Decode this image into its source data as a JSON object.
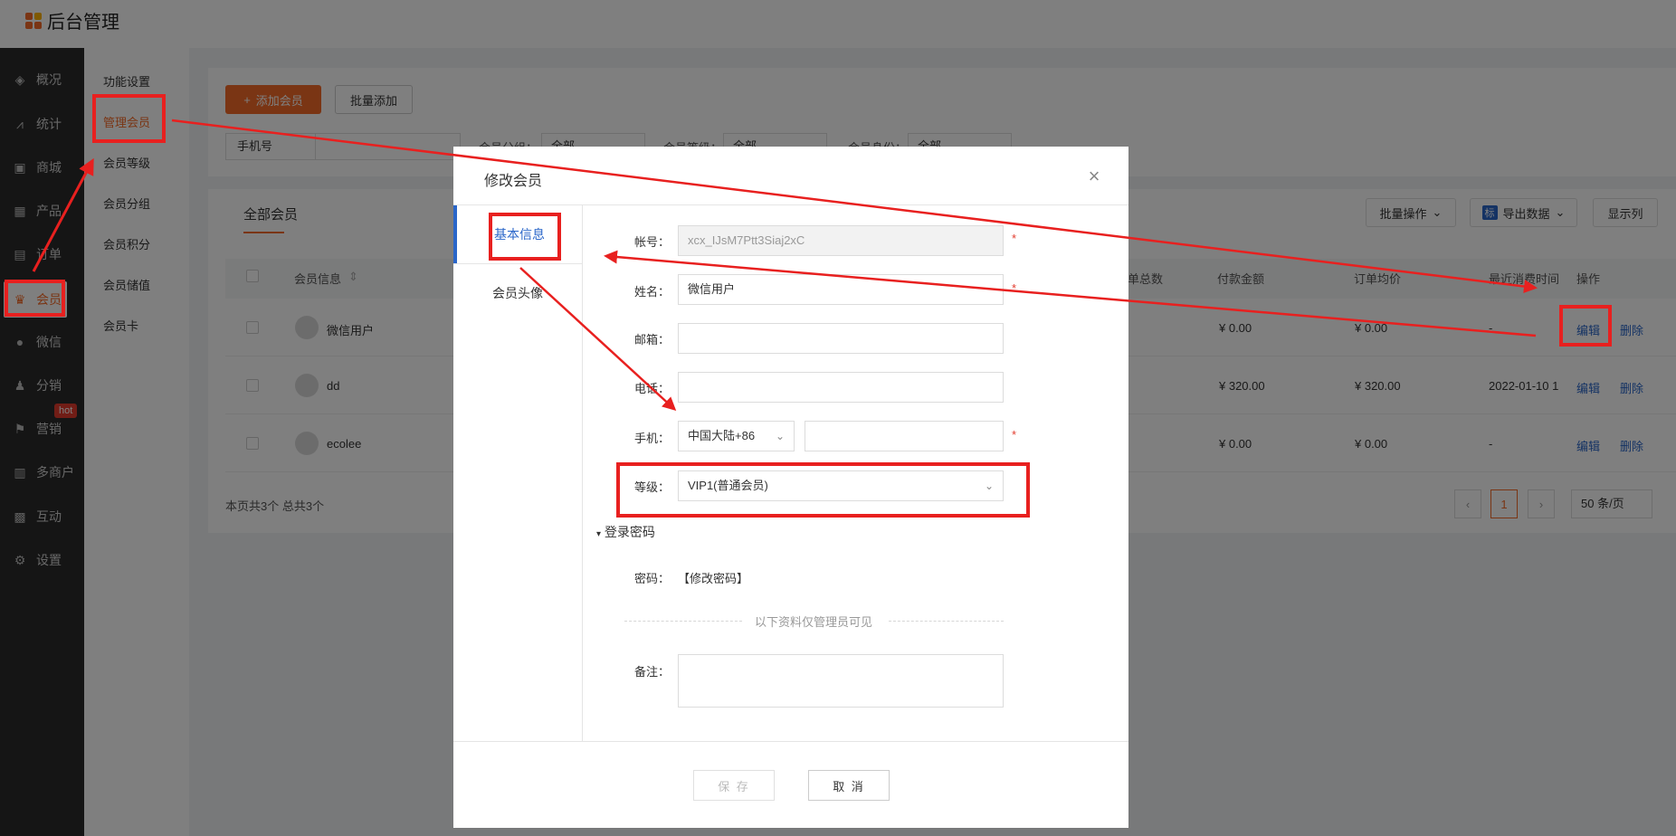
{
  "app": {
    "title": "后台管理"
  },
  "sidebar": {
    "items": [
      {
        "label": "概况",
        "icon": "layers-icon"
      },
      {
        "label": "统计",
        "icon": "chart-icon"
      },
      {
        "label": "商城",
        "icon": "shop-icon"
      },
      {
        "label": "产品",
        "icon": "grid-icon"
      },
      {
        "label": "订单",
        "icon": "order-icon"
      },
      {
        "label": "会员",
        "icon": "crown-icon"
      },
      {
        "label": "微信",
        "icon": "wechat-icon"
      },
      {
        "label": "分销",
        "icon": "user-share-icon"
      },
      {
        "label": "营销",
        "icon": "flag-icon"
      },
      {
        "label": "多商户",
        "icon": "store-icon"
      },
      {
        "label": "互动",
        "icon": "apps-icon"
      },
      {
        "label": "设置",
        "icon": "gear-icon"
      }
    ],
    "hot_badge": "hot"
  },
  "subnav": {
    "items": [
      "功能设置",
      "管理会员",
      "会员等级",
      "会员分组",
      "会员积分",
      "会员储值",
      "会员卡"
    ]
  },
  "toolbar": {
    "add_label": "添加会员",
    "batch_add_label": "批量添加",
    "filter_phone": "手机号",
    "filter_group_label": "会员分组：",
    "filter_group_value": "全部",
    "filter_level_label": "会员等级：",
    "filter_level_value": "全部",
    "filter_identity_label": "会员身份：",
    "filter_identity_value": "全部"
  },
  "list": {
    "tab": "全部会员",
    "batch_ops": "批量操作",
    "export_badge": "标",
    "export": "导出数据",
    "display_cols": "显示列",
    "headers": {
      "member_info": "会员信息",
      "order_count": "单总数",
      "paid_amount": "付款金额",
      "order_avg": "订单均价",
      "last_consume": "最近消费时间",
      "actions": "操作"
    },
    "rows": [
      {
        "name": "微信用户",
        "paid": "¥ 0.00",
        "avg": "¥ 0.00",
        "last": "-",
        "edit": "编辑",
        "delete": "删除"
      },
      {
        "name": "dd",
        "paid": "¥ 320.00",
        "avg": "¥ 320.00",
        "last": "2022-01-10 1",
        "edit": "编辑",
        "delete": "删除"
      },
      {
        "name": "ecolee",
        "paid": "¥ 0.00",
        "avg": "¥ 0.00",
        "last": "-",
        "edit": "编辑",
        "delete": "删除"
      }
    ],
    "footer": "本页共3个 总共3个",
    "pager": {
      "prev": "‹",
      "current": "1",
      "next": "›",
      "page_size": "50 条/页"
    }
  },
  "modal": {
    "title": "修改会员",
    "close": "×",
    "tabs": [
      "基本信息",
      "会员头像"
    ],
    "fields": {
      "account_label": "帐号：",
      "account_value": "xcx_IJsM7Ptt3Siaj2xC",
      "name_label": "姓名：",
      "name_value": "微信用户",
      "email_label": "邮箱：",
      "phone_label": "电话：",
      "mobile_label": "手机：",
      "mobile_region": "中国大陆+86",
      "level_label": "等级：",
      "level_value": "VIP1(普通会员)",
      "required_mark": "*"
    },
    "login_section": "登录密码",
    "password_label": "密码：",
    "password_link": "【修改密码】",
    "admin_only": "以下资料仅管理员可见",
    "remark_label": "备注：",
    "save": "保 存",
    "cancel": "取 消"
  },
  "colors": {
    "accent": "#f56b28",
    "link": "#2a66c9",
    "annotation": "#e8201f"
  }
}
